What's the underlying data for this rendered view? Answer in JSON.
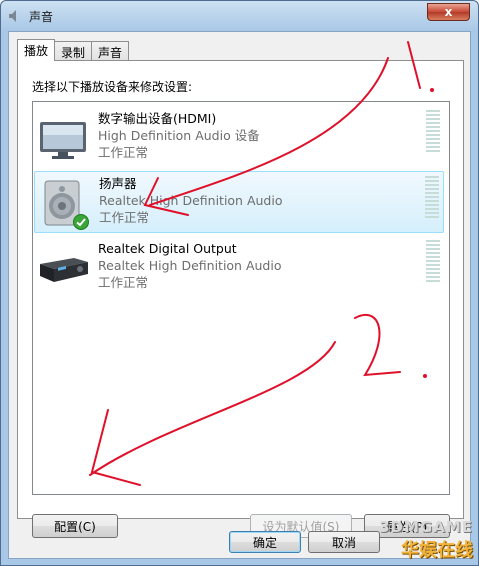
{
  "window": {
    "title": "声音",
    "close_glyph": "x"
  },
  "tabs": [
    {
      "label": "播放",
      "active": true
    },
    {
      "label": "录制",
      "active": false
    },
    {
      "label": "声音",
      "active": false
    }
  ],
  "instruction": "选择以下播放设备来修改设置:",
  "devices": [
    {
      "name": "数字输出设备(HDMI)",
      "driver": "High Definition Audio 设备",
      "status": "工作正常",
      "icon": "monitor-icon",
      "selected": false
    },
    {
      "name": "扬声器",
      "driver": "Realtek High Definition Audio",
      "status": "工作正常",
      "icon": "speaker-icon",
      "selected": true,
      "default_badge": "check-icon"
    },
    {
      "name": "Realtek Digital Output",
      "driver": "Realtek High Definition Audio",
      "status": "工作正常",
      "icon": "digital-receiver-icon",
      "selected": false
    }
  ],
  "buttons": {
    "configure": "配置(C)",
    "set_default": "设为默认值(S)",
    "properties": "属性(P)",
    "ok": "确定",
    "cancel": "取消"
  },
  "annotations": {
    "step1": "1.",
    "step2": "2.",
    "color": "#e0102a"
  },
  "watermark": {
    "line1": "3DMGAME",
    "line2": "华娱在线"
  },
  "colors": {
    "selected_bg": "#d5effc",
    "selected_border": "#99defd",
    "secondary_text": "#6d6d6d"
  }
}
